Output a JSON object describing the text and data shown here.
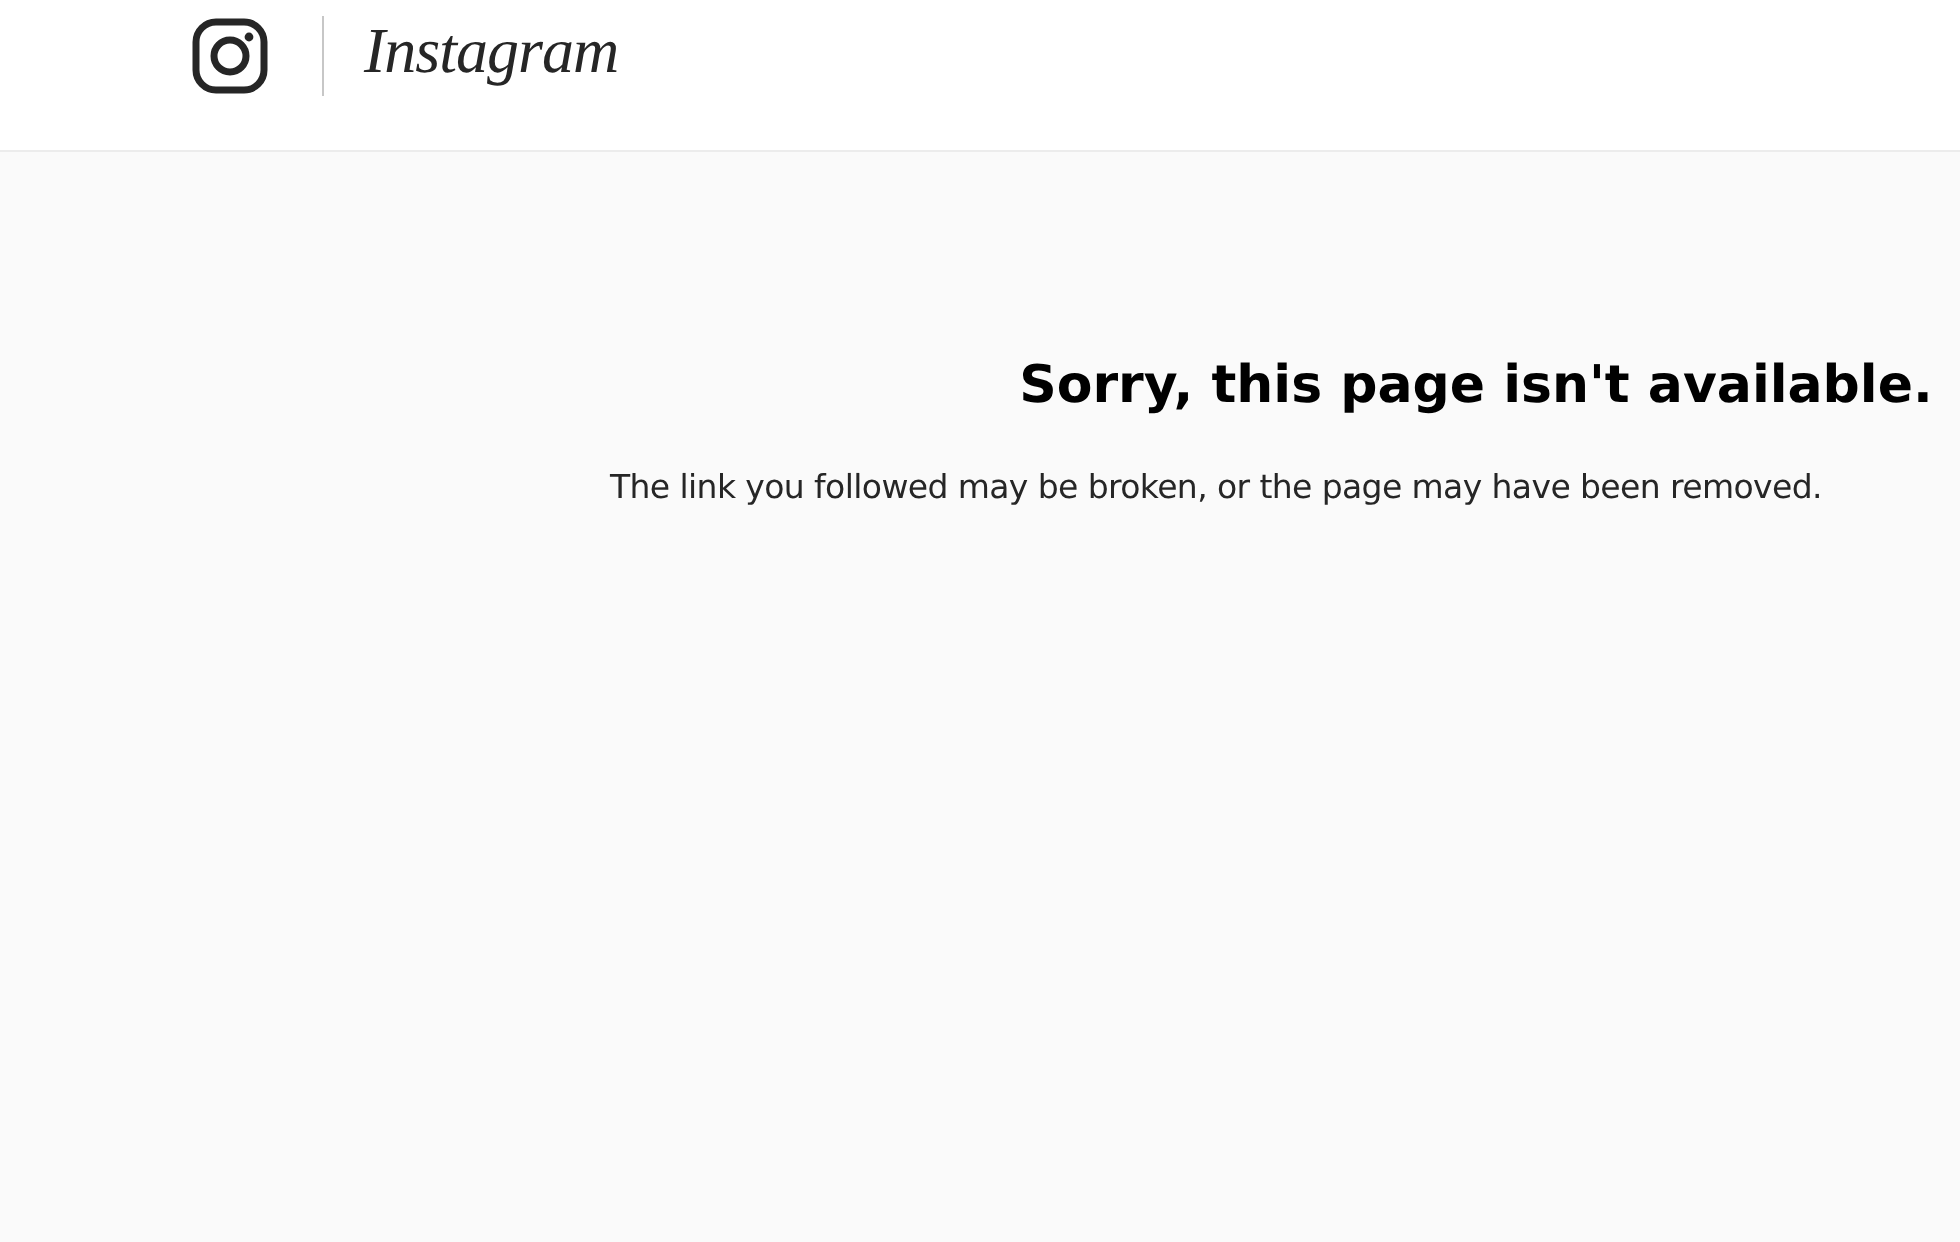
{
  "header": {
    "logo_text": "Instagram"
  },
  "error": {
    "title": "Sorry, this page isn't available.",
    "message": "The link you followed may be broken, or the page may have been removed."
  }
}
